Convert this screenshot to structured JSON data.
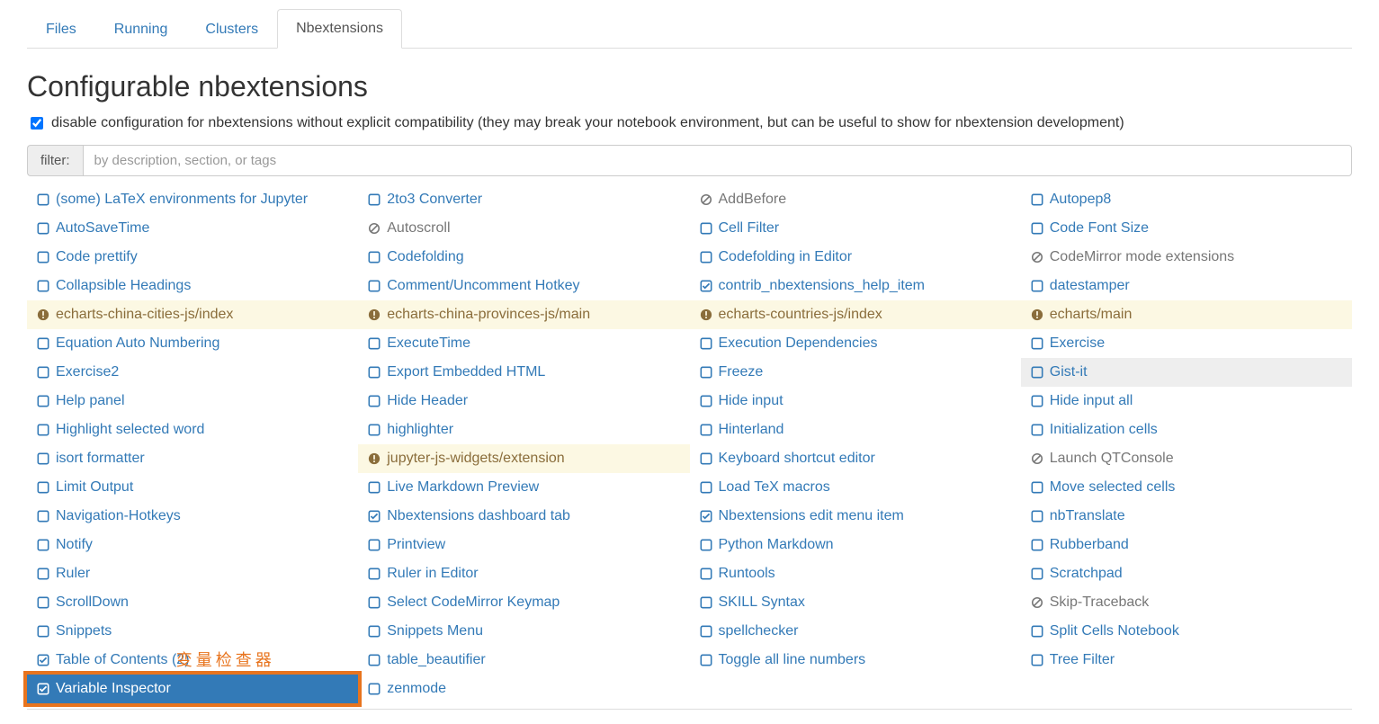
{
  "tabs": {
    "files": "Files",
    "running": "Running",
    "clusters": "Clusters",
    "nbextensions": "Nbextensions"
  },
  "page_title": "Configurable nbextensions",
  "compat": {
    "checked": true,
    "label": "disable configuration for nbextensions without explicit compatibility (they may break your notebook environment, but can be useful to show for nbextension development)"
  },
  "filter": {
    "label": "filter:",
    "placeholder": "by description, section, or tags",
    "value": ""
  },
  "annotation": "变量检查器",
  "extensions": [
    {
      "label": "(some) LaTeX environments for Jupyter",
      "state": "unchecked"
    },
    {
      "label": "2to3 Converter",
      "state": "unchecked"
    },
    {
      "label": "AddBefore",
      "state": "ban"
    },
    {
      "label": "Autopep8",
      "state": "unchecked"
    },
    {
      "label": "AutoSaveTime",
      "state": "unchecked"
    },
    {
      "label": "Autoscroll",
      "state": "ban"
    },
    {
      "label": "Cell Filter",
      "state": "unchecked"
    },
    {
      "label": "Code Font Size",
      "state": "unchecked"
    },
    {
      "label": "Code prettify",
      "state": "unchecked"
    },
    {
      "label": "Codefolding",
      "state": "unchecked"
    },
    {
      "label": "Codefolding in Editor",
      "state": "unchecked"
    },
    {
      "label": "CodeMirror mode extensions",
      "state": "ban"
    },
    {
      "label": "Collapsible Headings",
      "state": "unchecked"
    },
    {
      "label": "Comment/Uncomment Hotkey",
      "state": "unchecked"
    },
    {
      "label": "contrib_nbextensions_help_item",
      "state": "checked"
    },
    {
      "label": "datestamper",
      "state": "unchecked"
    },
    {
      "label": "echarts-china-cities-js/index",
      "state": "warn"
    },
    {
      "label": "echarts-china-provinces-js/main",
      "state": "warn"
    },
    {
      "label": "echarts-countries-js/index",
      "state": "warn"
    },
    {
      "label": "echarts/main",
      "state": "warn"
    },
    {
      "label": "Equation Auto Numbering",
      "state": "unchecked"
    },
    {
      "label": "ExecuteTime",
      "state": "unchecked"
    },
    {
      "label": "Execution Dependencies",
      "state": "unchecked"
    },
    {
      "label": "Exercise",
      "state": "unchecked"
    },
    {
      "label": "Exercise2",
      "state": "unchecked"
    },
    {
      "label": "Export Embedded HTML",
      "state": "unchecked"
    },
    {
      "label": "Freeze",
      "state": "unchecked"
    },
    {
      "label": "Gist-it",
      "state": "unchecked",
      "bg": "gray"
    },
    {
      "label": "Help panel",
      "state": "unchecked"
    },
    {
      "label": "Hide Header",
      "state": "unchecked"
    },
    {
      "label": "Hide input",
      "state": "unchecked"
    },
    {
      "label": "Hide input all",
      "state": "unchecked"
    },
    {
      "label": "Highlight selected word",
      "state": "unchecked"
    },
    {
      "label": "highlighter",
      "state": "unchecked"
    },
    {
      "label": "Hinterland",
      "state": "unchecked"
    },
    {
      "label": "Initialization cells",
      "state": "unchecked"
    },
    {
      "label": "isort formatter",
      "state": "unchecked"
    },
    {
      "label": "jupyter-js-widgets/extension",
      "state": "warn"
    },
    {
      "label": "Keyboard shortcut editor",
      "state": "unchecked"
    },
    {
      "label": "Launch QTConsole",
      "state": "ban"
    },
    {
      "label": "Limit Output",
      "state": "unchecked"
    },
    {
      "label": "Live Markdown Preview",
      "state": "unchecked"
    },
    {
      "label": "Load TeX macros",
      "state": "unchecked"
    },
    {
      "label": "Move selected cells",
      "state": "unchecked"
    },
    {
      "label": "Navigation-Hotkeys",
      "state": "unchecked"
    },
    {
      "label": "Nbextensions dashboard tab",
      "state": "checked"
    },
    {
      "label": "Nbextensions edit menu item",
      "state": "checked"
    },
    {
      "label": "nbTranslate",
      "state": "unchecked"
    },
    {
      "label": "Notify",
      "state": "unchecked"
    },
    {
      "label": "Printview",
      "state": "unchecked"
    },
    {
      "label": "Python Markdown",
      "state": "unchecked"
    },
    {
      "label": "Rubberband",
      "state": "unchecked"
    },
    {
      "label": "Ruler",
      "state": "unchecked"
    },
    {
      "label": "Ruler in Editor",
      "state": "unchecked"
    },
    {
      "label": "Runtools",
      "state": "unchecked"
    },
    {
      "label": "Scratchpad",
      "state": "unchecked"
    },
    {
      "label": "ScrollDown",
      "state": "unchecked"
    },
    {
      "label": "Select CodeMirror Keymap",
      "state": "unchecked"
    },
    {
      "label": "SKILL Syntax",
      "state": "unchecked"
    },
    {
      "label": "Skip-Traceback",
      "state": "ban"
    },
    {
      "label": "Snippets",
      "state": "unchecked"
    },
    {
      "label": "Snippets Menu",
      "state": "unchecked"
    },
    {
      "label": "spellchecker",
      "state": "unchecked"
    },
    {
      "label": "Split Cells Notebook",
      "state": "unchecked"
    },
    {
      "label": "Table of Contents (2)",
      "state": "checked"
    },
    {
      "label": "table_beautifier",
      "state": "unchecked"
    },
    {
      "label": "Toggle all line numbers",
      "state": "unchecked"
    },
    {
      "label": "Tree Filter",
      "state": "unchecked"
    },
    {
      "label": "Variable Inspector",
      "state": "checked",
      "selected": true
    },
    {
      "label": "zenmode",
      "state": "unchecked"
    }
  ]
}
